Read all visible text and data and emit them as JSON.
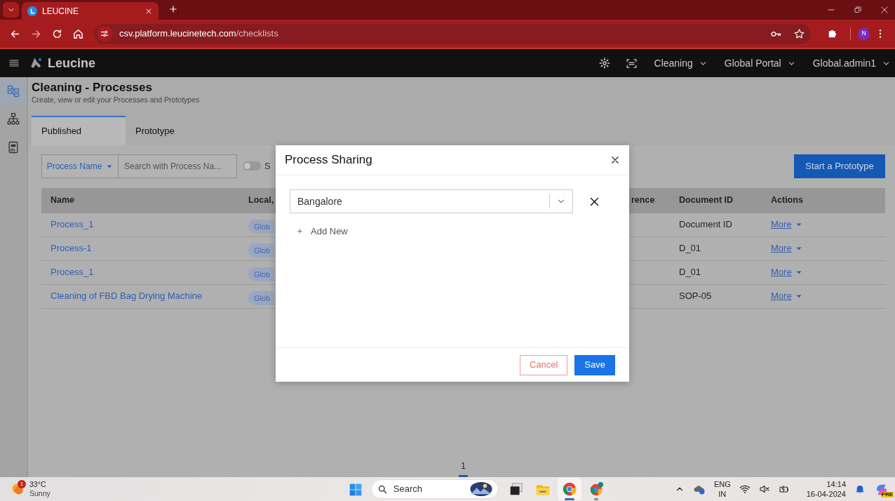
{
  "browser": {
    "tabs": [
      {
        "title": "LEUCINE",
        "selected": true
      }
    ],
    "url": {
      "host": "csv.platform.leucinetech.com",
      "path": "/checklists"
    },
    "profile": "N"
  },
  "navbar": {
    "brand": "Leucine",
    "menus": [
      "Cleaning",
      "Global Portal",
      "Global.admin1"
    ]
  },
  "sidebar": {
    "items": [
      {
        "kind": "flow",
        "selected": true
      },
      {
        "kind": "hierarchy",
        "selected": false
      },
      {
        "kind": "report",
        "selected": false
      }
    ]
  },
  "page": {
    "title": "Cleaning - Processes",
    "subtitle": "Create, view or edit your Processes and Prototypes"
  },
  "tabs": [
    {
      "label": "Published",
      "selected": true
    },
    {
      "label": "Prototype",
      "selected": false
    }
  ],
  "filter": {
    "field": "Process Name",
    "placeholder": "Search with Process Na...",
    "toggle": {
      "on": false
    },
    "toggle_label": "S"
  },
  "primary_button": "Start a Prototype",
  "table": {
    "columns": [
      "Name",
      "Local,",
      "rence",
      "Document ID",
      "Actions"
    ],
    "rows": [
      {
        "name": "Process_1",
        "badge": "Glob",
        "document_id": "Document ID",
        "action": "More"
      },
      {
        "name": "Process-1",
        "badge": "Glob",
        "document_id": "D_01",
        "action": "More"
      },
      {
        "name": "Process_1",
        "badge": "Glob",
        "document_id": "D_01",
        "action": "More"
      },
      {
        "name": "Cleaning of FBD Bag Drying Machine",
        "badge": "Glob",
        "document_id": "SOP-05",
        "action": "More"
      }
    ]
  },
  "pagination": [
    {
      "label": "1",
      "selected": true
    }
  ],
  "modal": {
    "title": "Process Sharing",
    "select": {
      "value": "Bangalore"
    },
    "add_new": "Add New",
    "buttons": [
      {
        "label": "Cancel",
        "kind": "outline"
      },
      {
        "label": "Save",
        "kind": "primary"
      }
    ]
  },
  "taskbar": {
    "weather": {
      "temp": "33°C",
      "condition": "Sunny",
      "badge": "1"
    },
    "search": {
      "label": "Search"
    },
    "apps": [
      {
        "kind": "task_view",
        "selected": false,
        "running": false
      },
      {
        "kind": "explorer",
        "selected": false,
        "running": false
      },
      {
        "kind": "chrome",
        "selected": true,
        "running": true
      },
      {
        "kind": "chrome_profile",
        "selected": false,
        "running": true
      }
    ],
    "tray": {
      "language": "ENG",
      "region": "IN",
      "time": "14:14",
      "date": "16-04-2024",
      "copilot_badge": "PRE"
    }
  }
}
